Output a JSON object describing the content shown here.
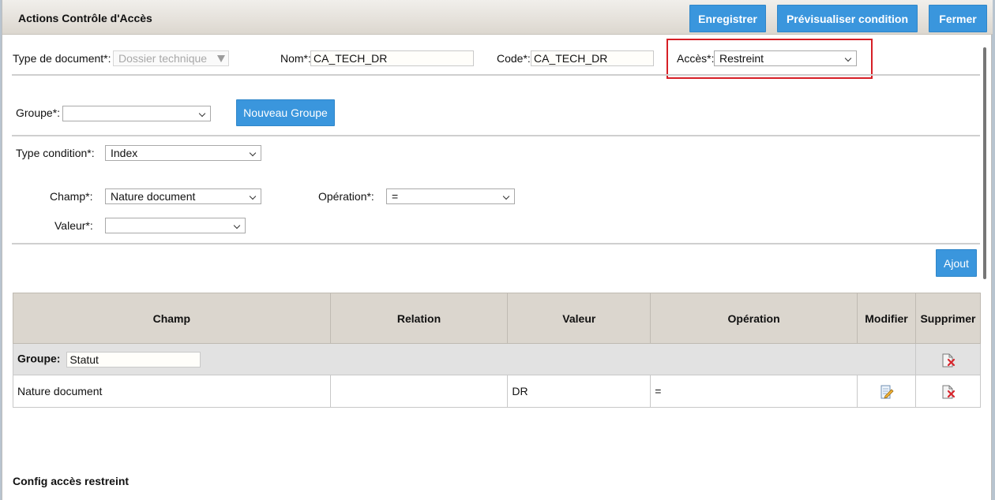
{
  "dialog": {
    "title": "Actions Contrôle d'Accès",
    "buttons": {
      "save": "Enregistrer",
      "preview": "Prévisualiser condition",
      "close": "Fermer"
    }
  },
  "form": {
    "doc_type": {
      "label": "Type de document*:",
      "value": "Dossier technique"
    },
    "name": {
      "label": "Nom*:",
      "value": "CA_TECH_DR"
    },
    "code": {
      "label": "Code*:",
      "value": "CA_TECH_DR"
    },
    "access": {
      "label": "Accès*:",
      "value": "Restreint"
    },
    "group": {
      "label": "Groupe*:",
      "value": "",
      "new_button": "Nouveau Groupe"
    },
    "condition_type": {
      "label": "Type condition*:",
      "value": "Index"
    },
    "field": {
      "label": "Champ*:",
      "value": "Nature document"
    },
    "operation": {
      "label": "Opération*:",
      "value": "="
    },
    "value": {
      "label": "Valeur*:",
      "value": ""
    },
    "add_button": "Ajout"
  },
  "table": {
    "columns": [
      "Champ",
      "Relation",
      "Valeur",
      "Opération",
      "Modifier",
      "Supprimer"
    ],
    "group_label": "Groupe:",
    "group_name": "Statut",
    "rows": [
      {
        "champ": "Nature document",
        "relation": "",
        "valeur": "DR",
        "operation": "="
      }
    ]
  },
  "footer": {
    "section_title": "Config accès restreint"
  },
  "colors": {
    "accent": "#3a96dd",
    "highlight": "#d61f26",
    "header_bg": "#dbd6ce"
  }
}
